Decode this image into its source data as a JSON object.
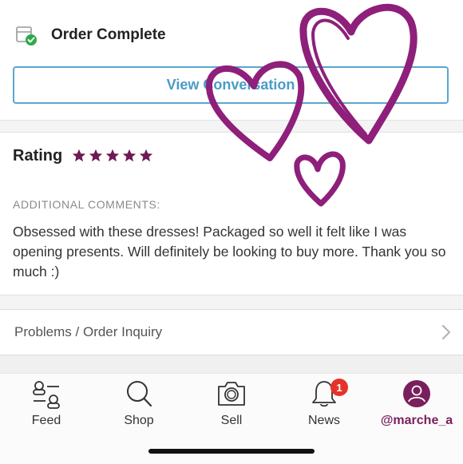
{
  "order": {
    "status": "Order Complete",
    "view_button": "View Conversation"
  },
  "rating": {
    "label": "Rating",
    "stars": 5,
    "max_stars": 5
  },
  "comments": {
    "heading": "ADDITIONAL COMMENTS:",
    "body": "Obsessed with these dresses! Packaged so well it felt like I was opening presents. Will definitely be looking to buy more. Thank you so much :)"
  },
  "inquiry": {
    "label": "Problems / Order Inquiry"
  },
  "tabbar": {
    "items": [
      {
        "label": "Feed",
        "icon": "feed-icon"
      },
      {
        "label": "Shop",
        "icon": "search-icon"
      },
      {
        "label": "Sell",
        "icon": "camera-icon"
      },
      {
        "label": "News",
        "icon": "bell-icon",
        "badge": "1"
      },
      {
        "label": "@marche_a",
        "icon": "profile-icon",
        "active": true
      }
    ]
  },
  "colors": {
    "accent": "#7a1f5e",
    "link_blue": "#4a9bc7",
    "badge_red": "#e5332a",
    "heart": "#8e1f7a"
  }
}
